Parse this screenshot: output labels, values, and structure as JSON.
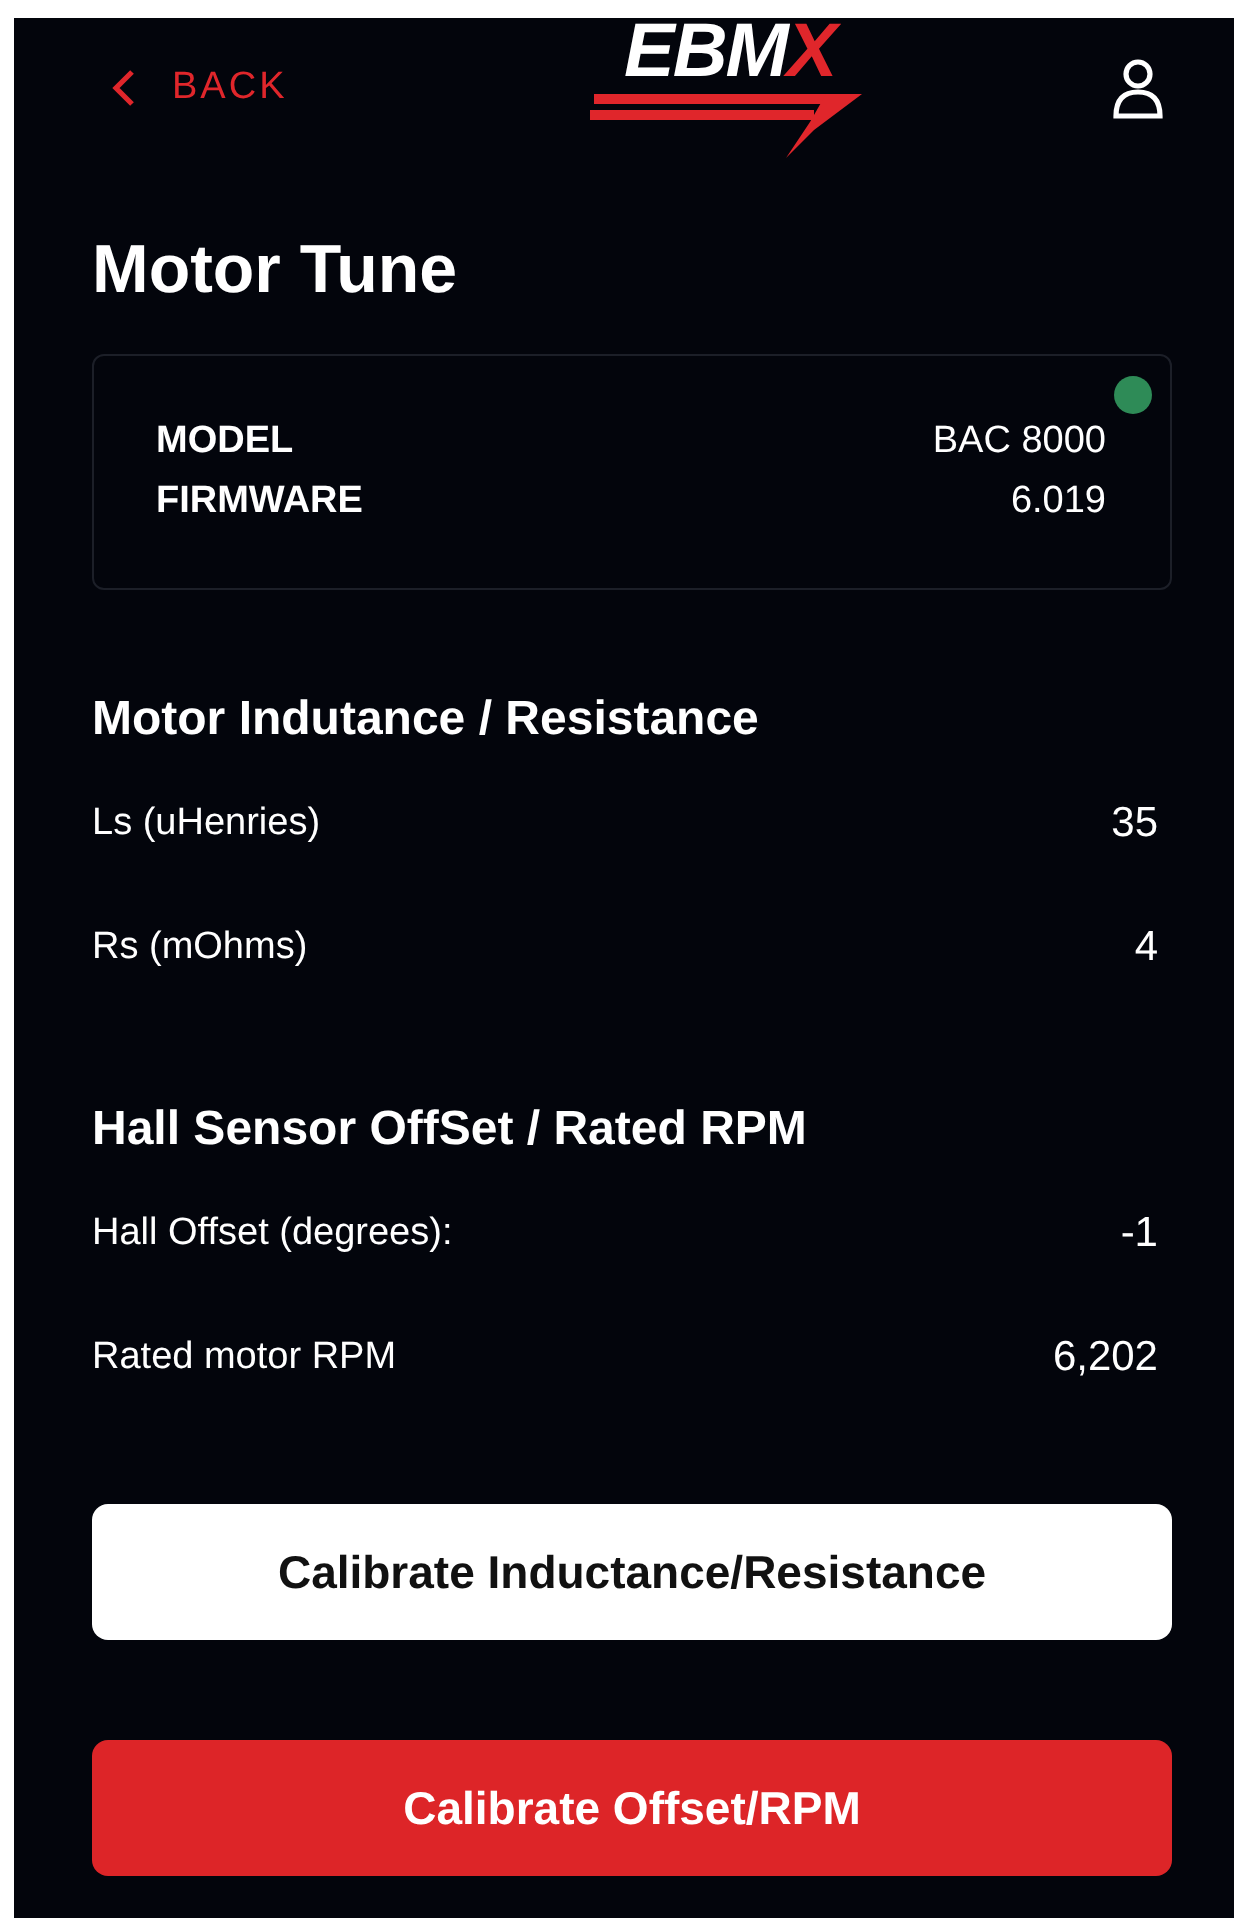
{
  "header": {
    "back": "BACK",
    "logo": {
      "text": "EBM",
      "accent": "X"
    }
  },
  "title": "Motor Tune",
  "device": {
    "connected": true,
    "rows": [
      {
        "label": "MODEL",
        "value": "BAC 8000"
      },
      {
        "label": "FIRMWARE",
        "value": "6.019"
      }
    ]
  },
  "sections": [
    {
      "heading": "Motor Indutance / Resistance",
      "rows": [
        {
          "label": "Ls (uHenries)",
          "value": "35"
        },
        {
          "label": "Rs (mOhms)",
          "value": "4"
        }
      ]
    },
    {
      "heading": "Hall Sensor OffSet / Rated RPM",
      "rows": [
        {
          "label": "Hall Offset (degrees):",
          "value": "-1"
        },
        {
          "label": "Rated motor RPM",
          "value": "6,202"
        }
      ]
    }
  ],
  "buttons": [
    {
      "label": "Calibrate Inductance/Resistance",
      "kind": "secondary"
    },
    {
      "label": "Calibrate Offset/RPM",
      "kind": "primary"
    }
  ]
}
